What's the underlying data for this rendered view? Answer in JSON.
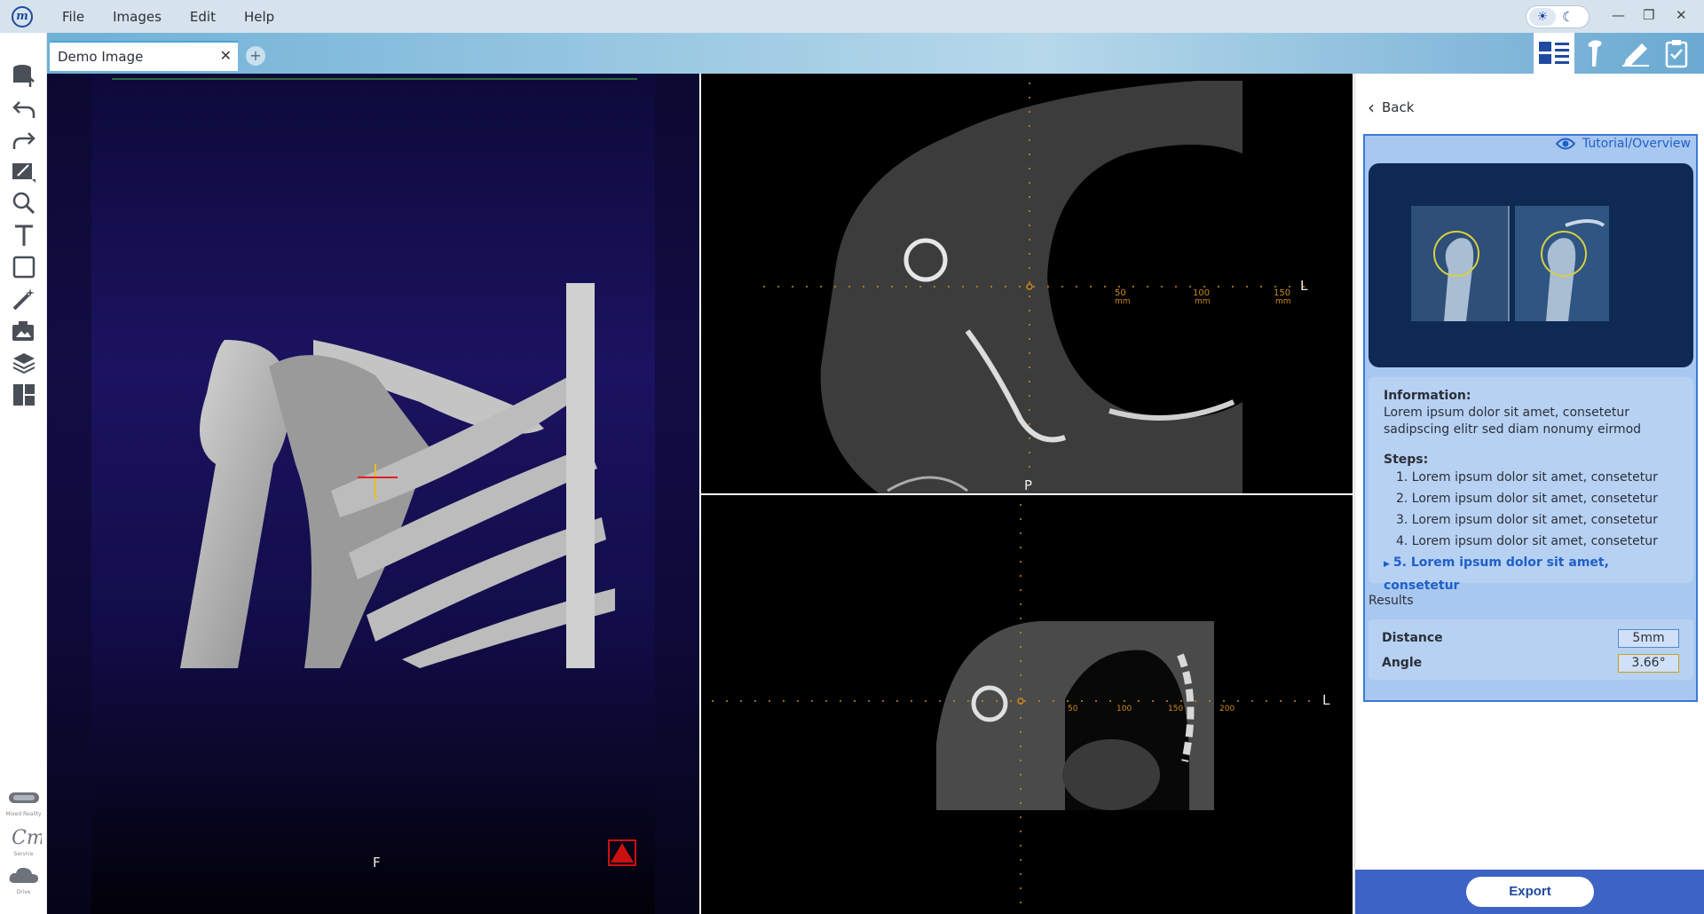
{
  "app": {
    "logo_letter": "m"
  },
  "menu": [
    "File",
    "Images",
    "Edit",
    "Help"
  ],
  "tabs": {
    "active_label": "Demo Image",
    "close_glyph": "✕",
    "add_glyph": "+"
  },
  "mode_buttons": [
    "layout-icon",
    "bone-icon",
    "pen-icon",
    "clipboard-icon"
  ],
  "left_toolbar": [
    "database-upload-icon",
    "undo-icon",
    "redo-icon",
    "annotate-image-icon",
    "zoom-icon",
    "text-icon",
    "crop-icon",
    "magic-wand-icon",
    "screenshot-icon",
    "layers-icon",
    "layout-grid-icon"
  ],
  "bottom_tools": [
    {
      "icon": "vr-headset-icon",
      "caption": "Mixed Reality"
    },
    {
      "icon": "service-icon",
      "caption": "Service"
    },
    {
      "icon": "cloud-drive-icon",
      "caption": "Drive"
    }
  ],
  "viewports": {
    "volume": {
      "orientation_label": "F"
    },
    "axial": {
      "side_label": "L",
      "bottom_label": "P",
      "scale": [
        "50",
        "100",
        "150"
      ],
      "scale_unit": "mm"
    },
    "coronal": {
      "side_label": "L",
      "scale": [
        "50",
        "100",
        "150",
        "200"
      ]
    }
  },
  "panel": {
    "back_label": "Back",
    "tutorial_link": "Tutorial/Overview",
    "info_title": "Information:",
    "info_text": "Lorem ipsum dolor sit amet, consetetur sadipscing elitr sed diam nonumy eirmod",
    "steps_title": "Steps:",
    "steps": [
      "1. Lorem ipsum dolor sit amet, consetetur",
      "2. Lorem ipsum dolor sit amet, consetetur",
      "3. Lorem ipsum dolor sit amet, consetetur",
      "4. Lorem ipsum dolor sit amet, consetetur",
      "5. Lorem ipsum dolor sit amet, consetetur"
    ],
    "active_step": 5,
    "results_title": "Results",
    "results": [
      {
        "label": "Distance",
        "value": "5mm"
      },
      {
        "label": "Angle",
        "value": "3.66°"
      }
    ],
    "export_label": "Export"
  },
  "colors": {
    "accent": "#3c78d8",
    "export_bar": "#3d63c4",
    "measure_orange": "#d08a1a"
  }
}
